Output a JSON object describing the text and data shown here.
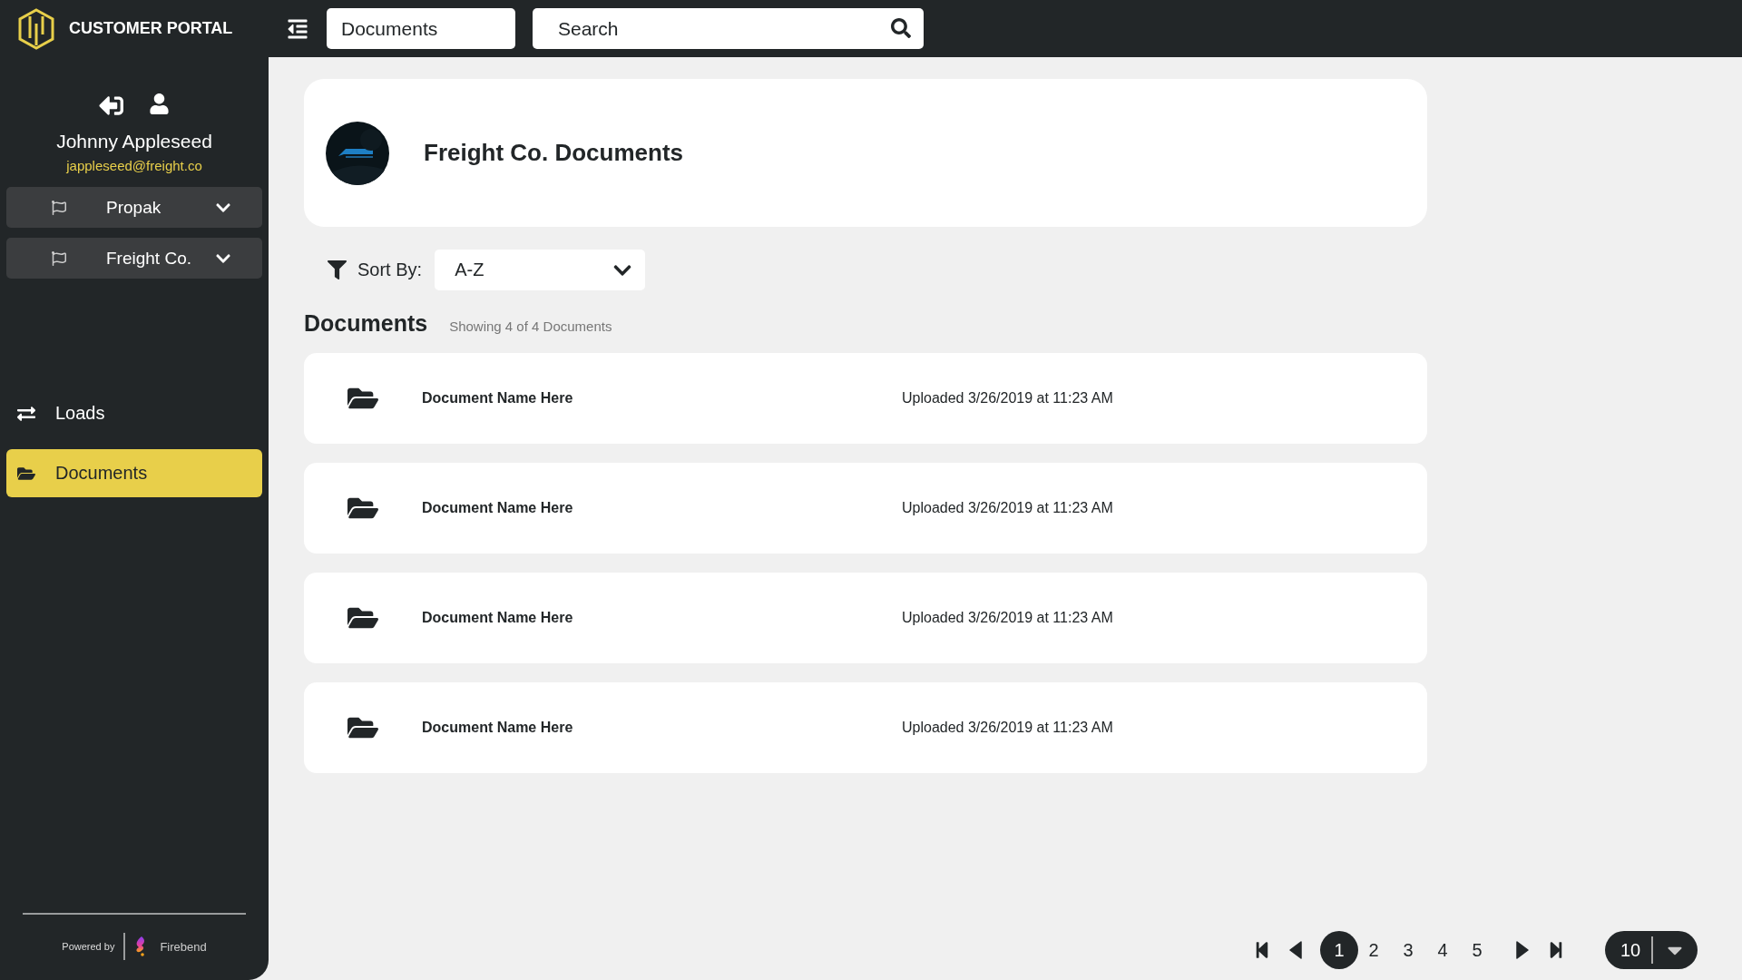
{
  "header": {
    "brand": "CUSTOMER PORTAL",
    "section_field": {
      "value": "Documents"
    },
    "search": {
      "placeholder": "Search"
    }
  },
  "user": {
    "name": "Johnny Appleseed",
    "email": "jappleseed@freight.co"
  },
  "accounts": [
    {
      "label": "Propak"
    },
    {
      "label": "Freight Co."
    }
  ],
  "nav": [
    {
      "label": "Loads",
      "kind": "arrows",
      "selected": false
    },
    {
      "label": "Documents",
      "kind": "folder",
      "selected": true
    }
  ],
  "footer": {
    "powered_by": "Powered by",
    "brand": "Firebend"
  },
  "page_card": {
    "title": "Freight Co. Documents"
  },
  "sort": {
    "label": "Sort By:",
    "value": "A-Z"
  },
  "documents": {
    "title": "Documents",
    "count": "Showing 4 of 4 Documents",
    "rows": [
      {
        "name": "Document Name Here",
        "uploaded": "Uploaded 3/26/2019 at 11:23 AM"
      },
      {
        "name": "Document Name Here",
        "uploaded": "Uploaded 3/26/2019 at 11:23 AM"
      },
      {
        "name": "Document Name Here",
        "uploaded": "Uploaded 3/26/2019 at 11:23 AM"
      },
      {
        "name": "Document Name Here",
        "uploaded": "Uploaded 3/26/2019 at 11:23 AM"
      }
    ]
  },
  "pagination": {
    "pages": [
      {
        "label": "1",
        "selected": true
      },
      {
        "label": "2",
        "selected": false
      },
      {
        "label": "3",
        "selected": false
      },
      {
        "label": "4",
        "selected": false
      },
      {
        "label": "5",
        "selected": false
      }
    ],
    "page_size": "10"
  }
}
